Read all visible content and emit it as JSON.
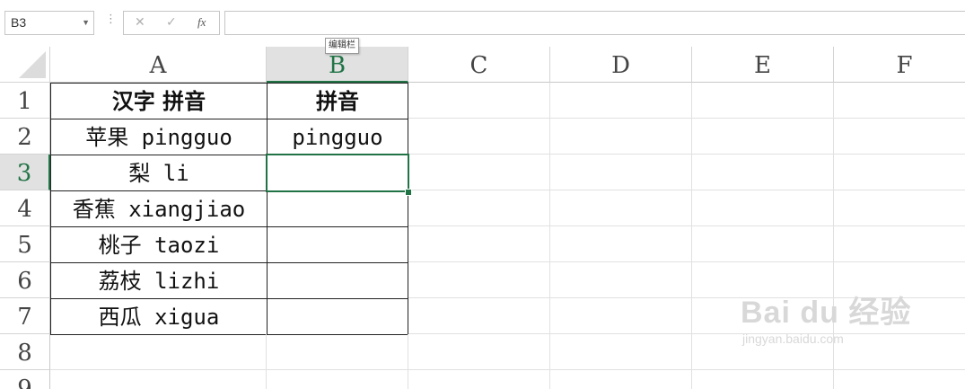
{
  "formula_bar": {
    "name_box": "B3",
    "cancel_icon": "✕",
    "enter_icon": "✓",
    "fx_label": "fx",
    "tooltip": "编辑栏",
    "formula": ""
  },
  "columns": [
    "A",
    "B",
    "C",
    "D",
    "E",
    "F"
  ],
  "rows": [
    "1",
    "2",
    "3",
    "4",
    "5",
    "6",
    "7",
    "8",
    "9"
  ],
  "selected_cell": "B3",
  "cells": {
    "A1": "汉字 拼音",
    "B1": "拼音",
    "A2": "苹果 pingguo",
    "B2": "pingguo",
    "A3": "梨 li",
    "B3": "",
    "A4": "香蕉 xiangjiao",
    "B4": "",
    "A5": "桃子 taozi",
    "B5": "",
    "A6": "荔枝 lizhi",
    "B6": "",
    "A7": "西瓜 xigua",
    "B7": ""
  },
  "watermark": {
    "brand": "Bai du 经验",
    "url": "jingyan.baidu.com"
  },
  "colors": {
    "selection": "#217346",
    "header_selected_bg": "#e1e1e1"
  }
}
